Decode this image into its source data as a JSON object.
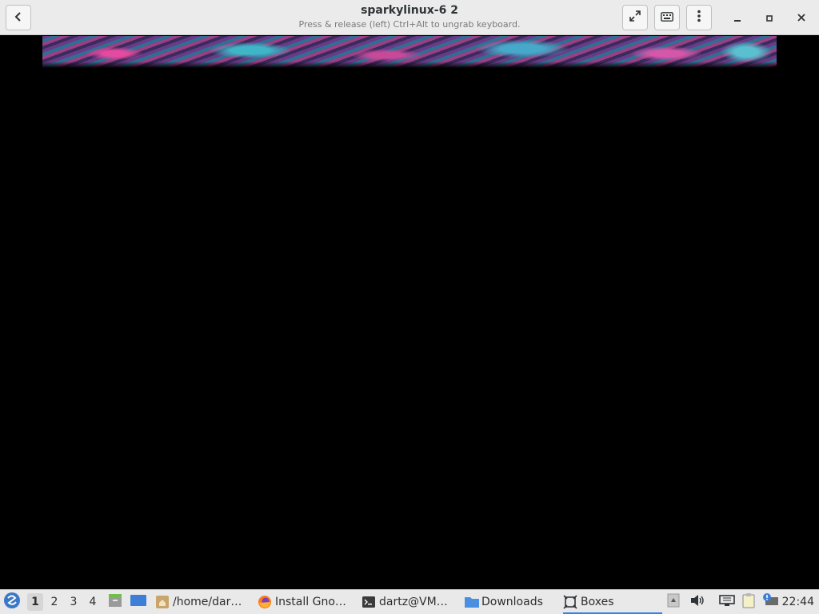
{
  "header": {
    "title": "sparkylinux-6 2",
    "subtitle": "Press & release (left) Ctrl+Alt to ungrab keyboard."
  },
  "icons": {
    "back": "back-arrow-icon",
    "fullscreen": "fullscreen-icon",
    "keyboard": "keyboard-icon",
    "menu": "kebab-menu-icon",
    "minimize": "minimize-icon",
    "maximize": "maximize-icon",
    "close": "close-icon"
  },
  "panel": {
    "workspaces": [
      "1",
      "2",
      "3",
      "4"
    ],
    "active_workspace": "1",
    "tasks": [
      {
        "label": "/home/dar…",
        "icon": "home-folder-icon"
      },
      {
        "label": "Install Gno…",
        "icon": "firefox-icon"
      },
      {
        "label": "dartz@VM…",
        "icon": "terminal-icon"
      },
      {
        "label": "Downloads",
        "icon": "folder-icon"
      },
      {
        "label": "Boxes",
        "icon": "boxes-icon",
        "active": true
      }
    ],
    "clock": "22:44"
  },
  "colors": {
    "accent": "#3584e4",
    "headerbar": "#ebebeb",
    "panel": "#e9e9e9"
  }
}
